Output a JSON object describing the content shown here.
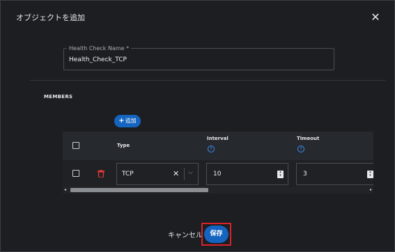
{
  "dialog": {
    "title": "オブジェクトを追加",
    "close_icon": "close-icon"
  },
  "form": {
    "name_label": "Health Check Name *",
    "name_value": "Health_Check_TCP"
  },
  "members": {
    "heading": "MEMBERS",
    "add_button": "追加",
    "add_icon": "plus-icon",
    "columns": [
      {
        "label": "Type",
        "help": false
      },
      {
        "label": "Interval",
        "help": true
      },
      {
        "label": "Timeout",
        "help": true
      }
    ],
    "rows": [
      {
        "type": "TCP",
        "interval": "10",
        "timeout": "3"
      }
    ],
    "help_glyph": "?"
  },
  "footer": {
    "cancel_label": "キャンセル",
    "save_label": "保存"
  },
  "colors": {
    "primary": "#1565c0",
    "highlight": "#d8232a",
    "delete": "#e53935",
    "help": "#3e8ef7"
  }
}
